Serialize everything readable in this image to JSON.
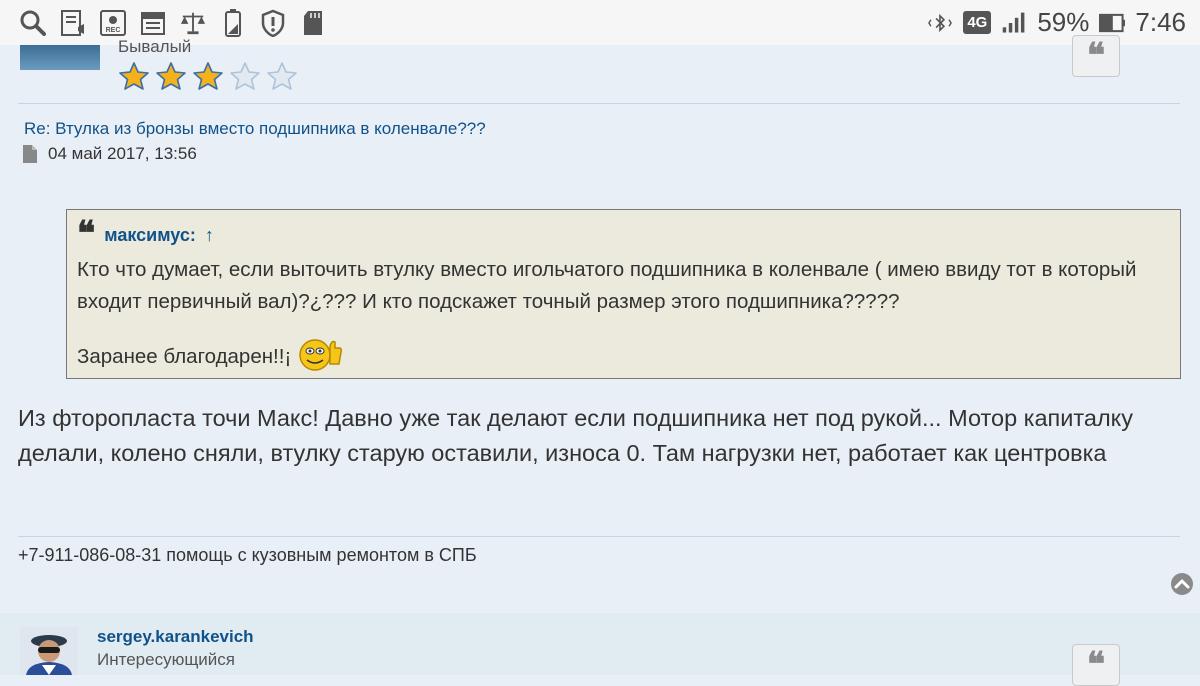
{
  "status_bar": {
    "icons": [
      "search-icon",
      "news-icon",
      "recorder-icon",
      "calendar-icon",
      "scales-icon",
      "battery-outline-icon",
      "shield-alert-icon",
      "sd-card-icon"
    ],
    "network": "4G",
    "battery_percent": "59%",
    "time": "7:46"
  },
  "post1": {
    "author_rank": "Бывалый",
    "stars_filled": 3,
    "stars_total": 5,
    "title": "Re: Втулка из бронзы вместо подшипника в коленвале???",
    "date": "04 май 2017, 13:56",
    "quote": {
      "author": "максимус:",
      "arrow": "↑",
      "text": "Кто что думает, если выточить втулку вместо игольчатого подшипника в коленвале ( имею ввиду тот в который входит первичный вал)?¿??? И кто подскажет точный размер этого подшипника?????",
      "thanks": "Заранее благодарен!!¡"
    },
    "body": "Из фторопласта точи Макс! Давно уже так делают если подшипника нет под рукой... Мотор капиталку делали, колено сняли, втулку старую оставили, износа 0. Там нагрузки нет, работает как центровка",
    "signature": "+7-911-086-08-31 помощь с кузовным ремонтом в СПБ"
  },
  "post2": {
    "author": "sergey.karankevich",
    "rank": "Интересующийся"
  },
  "colors": {
    "link": "#105289",
    "post_bg": "#e9eff6",
    "quote_bg": "#ebeadd",
    "star": "#f3b21c"
  }
}
